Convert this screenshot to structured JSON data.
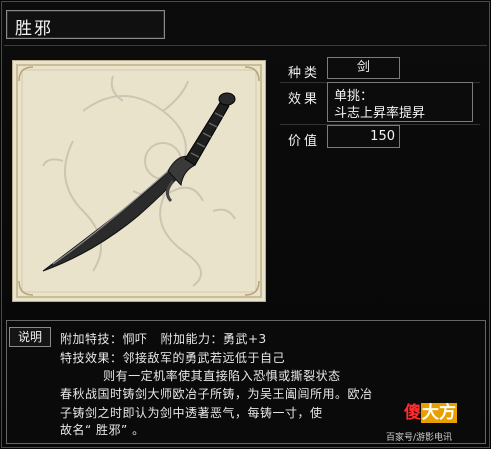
{
  "item": {
    "title": "胜邪",
    "image_name": "sword-illustration"
  },
  "stats": {
    "type_label": "种类",
    "type_value": "剑",
    "effect_label": "效果",
    "effect_line1": "单挑：",
    "effect_line2": "斗志上昇率提昇",
    "price_label": "价值",
    "price_value": "150"
  },
  "description": {
    "tag": "说明",
    "lines": [
      "附加特技：恫吓   附加能力：勇武+3",
      "特技效果：邻接敌军的勇武若远低于自己",
      "          则有一定机率使其直接陷入恐惧或撕裂状态",
      "春秋战国时铸剑大师欧冶子所铸，为吴王阖闾所用。欧冶",
      "子铸剑之时即认为剑中透著恶气，每铸一寸，使",
      "故名“ 胜邪” 。"
    ]
  },
  "watermark": {
    "logo_part1": "傻",
    "logo_part2": "大方",
    "caption": "百家号/游影电讯"
  },
  "colors": {
    "background": "#050505",
    "panel_border": "#7c7c7c",
    "parchment": "#eae3cc"
  }
}
